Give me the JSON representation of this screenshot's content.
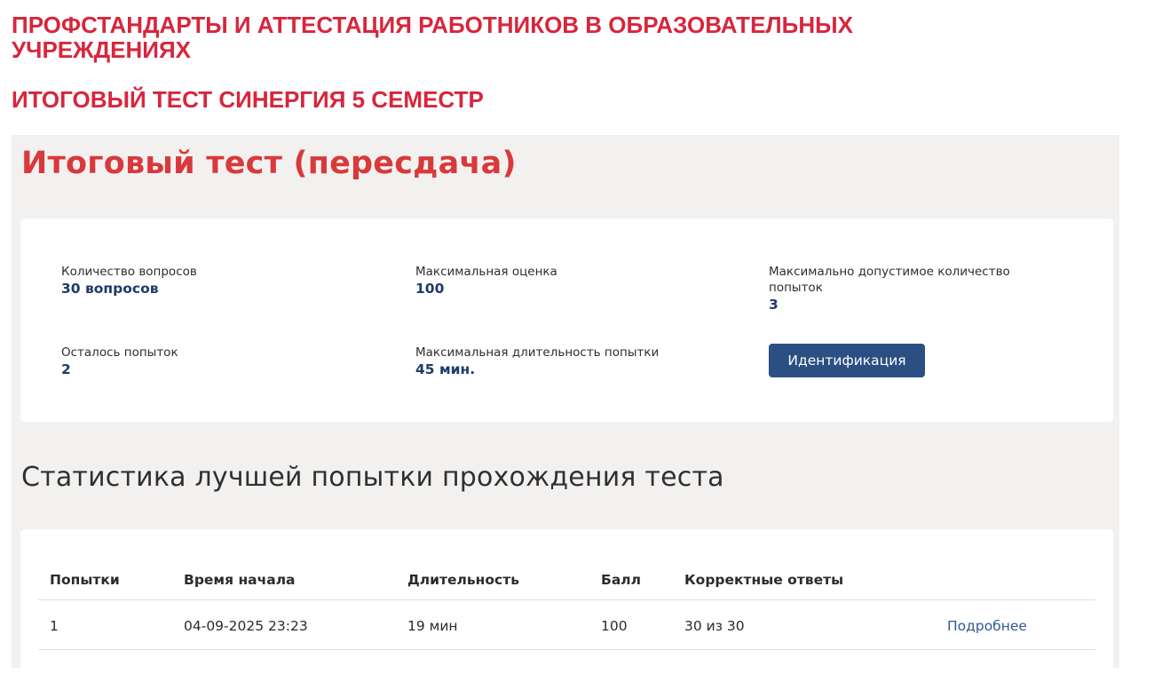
{
  "document": {
    "heading_1": "ПРОФСТАНДАРТЫ И АТТЕСТАЦИЯ РАБОТНИКОВ В ОБРАЗОВАТЕЛЬНЫХ УЧРЕЖДЕНИЯХ",
    "heading_2": "ИТОГОВЫЙ ТЕСТ СИНЕРГИЯ 5 СЕМЕСТР"
  },
  "test": {
    "title": "Итоговый тест (пересдача)",
    "info": {
      "questions_label": "Количество вопросов",
      "questions_value": "30 вопросов",
      "max_grade_label": "Максимальная оценка",
      "max_grade_value": "100",
      "max_attempts_label": "Максимально допустимое количество попыток",
      "max_attempts_value": "3",
      "remaining_label": "Осталось попыток",
      "remaining_value": "2",
      "duration_label": "Максимальная длительность попытки",
      "duration_value": "45 мин."
    },
    "identify_button": "Идентификация"
  },
  "stats": {
    "title": "Статистика лучшей попытки прохождения теста",
    "columns": [
      "Попытки",
      "Время начала",
      "Длительность",
      "Балл",
      "Корректные ответы"
    ],
    "rows": [
      {
        "attempt": "1",
        "start": "04-09-2025 23:23",
        "duration": "19 мин",
        "score": "100",
        "correct": "30 из 30",
        "details": "Подробнее"
      }
    ]
  },
  "colors": {
    "heading_red": "#d7263d",
    "title_red": "#d9393b",
    "value_blue": "#1f3b6b",
    "button_blue": "#2b4f82",
    "link_blue": "#2e5a93",
    "panel_bg": "#f2f1f0"
  }
}
